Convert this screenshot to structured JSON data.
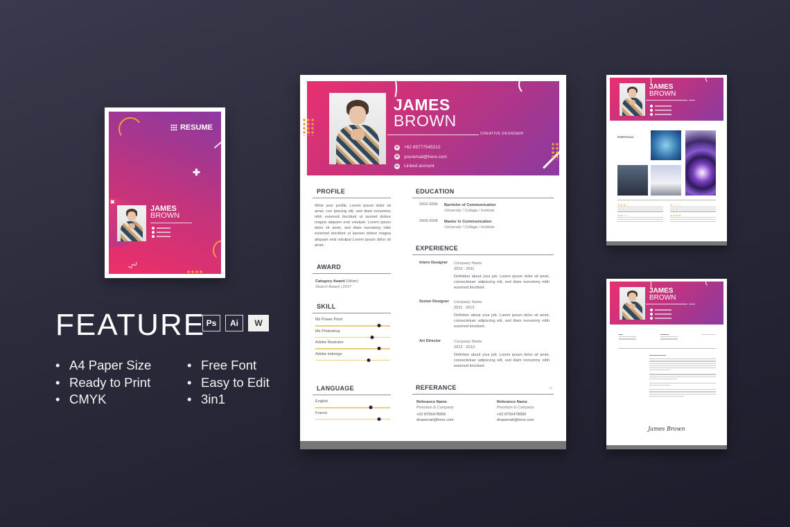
{
  "colors": {
    "background": "#2a2a3b",
    "gradient_start": "#e9306f",
    "gradient_end": "#8b3a9f",
    "accent_orange": "#f59a3b",
    "skill_bar": "#f1c97a",
    "heading_text": "#3c3c48"
  },
  "cover": {
    "title": "RESUME",
    "first_name": "JAMES",
    "last_name": "BROWN",
    "icons": [
      "dot-grid-icon",
      "plus-icon",
      "x-icon",
      "arc-decoration",
      "zigzag-decoration"
    ]
  },
  "feature": {
    "title": "FEATURE",
    "apps": [
      {
        "label": "Ps",
        "icon": "photoshop-icon"
      },
      {
        "label": "Ai",
        "icon": "illustrator-icon"
      },
      {
        "label": "W",
        "icon": "word-icon"
      }
    ],
    "list_left": [
      "A4 Paper Size",
      "Ready to Print",
      "CMYK"
    ],
    "list_right": [
      "Free Font",
      "Easy to Edit",
      "3in1"
    ]
  },
  "resume": {
    "first_name": "JAMES",
    "last_name": "BROWN",
    "role": "CREATIVE DESIGNER",
    "contacts": [
      {
        "icon": "phone-icon",
        "glyph": "✆",
        "text": "+62 85777545212"
      },
      {
        "icon": "email-icon",
        "glyph": "✉",
        "text": "youremail@here.com"
      },
      {
        "icon": "linkedin-icon",
        "glyph": "in",
        "text": "Linked account"
      }
    ],
    "profile": {
      "heading": "PROFILE",
      "text": "Write your profile. Lorem ipsum dolor sit amet, con ipiscing elit, sed diam nonummy nibh euismod tincidunt ut laoreet dolore magna aliquam erat volutpat. Lorem ipsum dolor sit amet,  sed diam nonummy nibh euismod tincidunt ut laoreet dolore magna aliquam erat volutpat Lorem ipsum dolor sit amet.."
    },
    "award": {
      "heading": "AWARD",
      "name": "Category Award",
      "level": "(Silver)",
      "detail": "Search Award | 2017"
    },
    "skill": {
      "heading": "SKILL",
      "items": [
        {
          "label": "Ms Power Point",
          "level": 0.85
        },
        {
          "label": "Ms Photoshop",
          "level": 0.76
        },
        {
          "label": "Adobe Illustrator",
          "level": 0.85
        },
        {
          "label": "Adobe indesign",
          "level": 0.71
        }
      ]
    },
    "language": {
      "heading": "LANGUAGE",
      "items": [
        {
          "label": "English",
          "level": 0.74
        },
        {
          "label": "France",
          "level": 0.85
        }
      ]
    },
    "education": {
      "heading": "EDUCATION",
      "items": [
        {
          "years": "2002-2006",
          "degree": "Bachelor of Communication",
          "school": "University / Collage / Institute"
        },
        {
          "years": "2006-2008",
          "degree": "Master in Communication",
          "school": "University / Collage / Institute"
        }
      ]
    },
    "experience": {
      "heading": "EXPERIENCE",
      "items": [
        {
          "role": "Intern Designer",
          "company": "Company Name",
          "years": "2010 - 2011",
          "desc": "Definition about your job. Lorem ipsum dolor sit amet, consectetuer adipiscing elit, sed diam nonummy nibh euismod tincidunt."
        },
        {
          "role": "Senior Designer",
          "company": "Company Name",
          "years": "2011 - 2012",
          "desc": "Defintion about your job. Lorem ipsum dolor sit amet, consectetuer adipiscing elit, sed diam nonummy nibh euismod tincidunt.."
        },
        {
          "role": "Art Director",
          "company": "Company Name",
          "years": "2012 - 2013",
          "desc": "Defintion about your job. Lorem ipsum dolor sit amet, consectetuer adipiscing elit, sed diam nonummy nibh euismod tincidunt."
        }
      ]
    },
    "reference": {
      "heading": "REFERANCE",
      "items": [
        {
          "name": "Referance Name",
          "position": "Posistion & Company",
          "phone": "+62 8756478999",
          "email": "dropemail@here.com"
        },
        {
          "name": "Referance Name",
          "position": "Posistion & Company",
          "phone": "+62 8756478999",
          "email": "dropemail@here.com"
        }
      ]
    }
  },
  "portfolio_page": {
    "first_name": "JAMES",
    "last_name": "BROWN",
    "section_label": "PORTFOLIO"
  },
  "letter_page": {
    "first_name": "JAMES",
    "last_name": "BROWN",
    "signature": "James Brown"
  }
}
